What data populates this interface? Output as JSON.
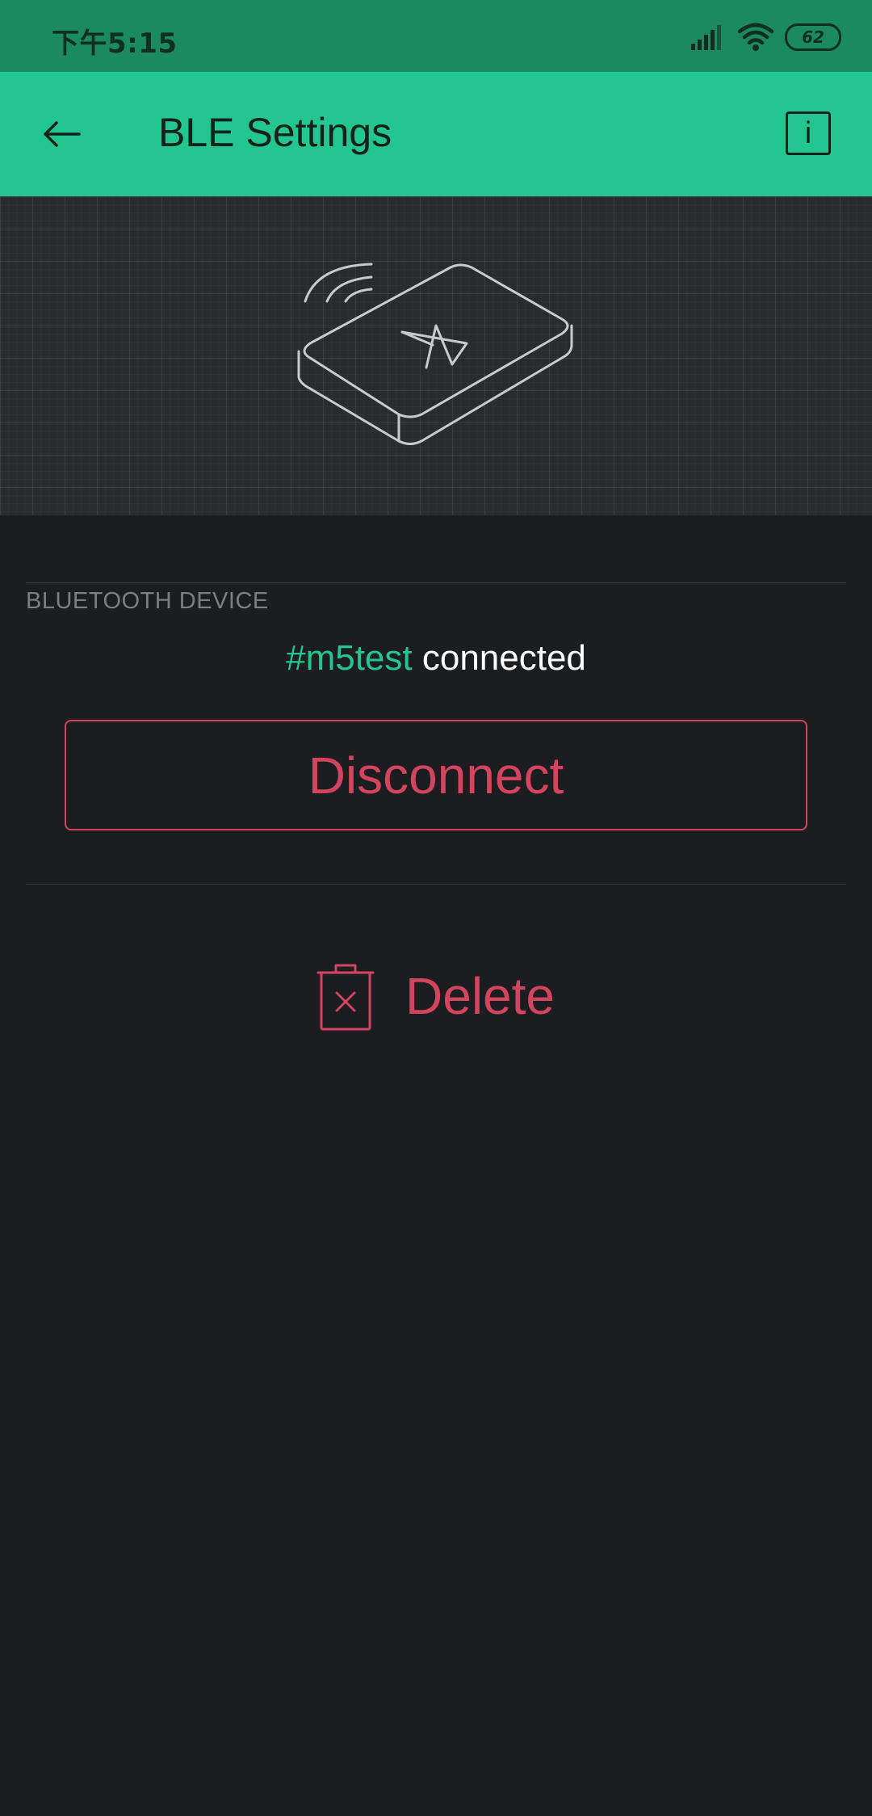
{
  "status_bar": {
    "time": "下午5:15",
    "battery": "62",
    "signal_icon": "signal-bars-icon",
    "wifi_icon": "wifi-icon"
  },
  "app_bar": {
    "title": "BLE Settings",
    "back_icon": "arrow-left-icon",
    "info_label": "i"
  },
  "hero": {
    "illustration": "bluetooth-device-illustration"
  },
  "section": {
    "label": "BLUETOOTH DEVICE",
    "device_name": "#m5test",
    "connection_status": "connected"
  },
  "actions": {
    "disconnect_label": "Disconnect",
    "delete_label": "Delete",
    "delete_icon": "trash-icon"
  },
  "colors": {
    "accent": "#23c690",
    "status_bar": "#1b8a61",
    "background": "#1c1d21",
    "danger": "#d3445e"
  }
}
